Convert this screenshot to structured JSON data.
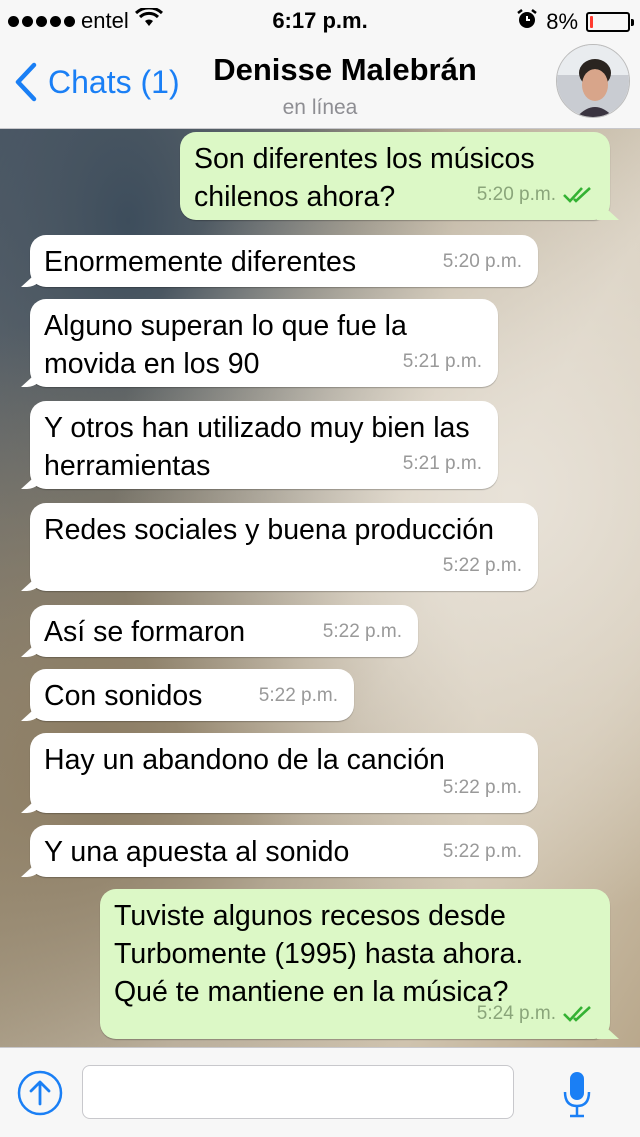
{
  "status_bar": {
    "carrier": "entel",
    "time": "6:17 p.m.",
    "battery": "8%",
    "battery_level": 0.08
  },
  "nav": {
    "back_label": "Chats (1)",
    "contact_name": "Denisse Malebrán",
    "contact_status": "en línea"
  },
  "messages": [
    {
      "direction": "out",
      "text": "Son diferentes los músicos chilenos ahora?",
      "time": "5:20 p.m.",
      "read": true
    },
    {
      "direction": "in",
      "text": "Enormemente diferentes",
      "time": "5:20 p.m."
    },
    {
      "direction": "in",
      "text": "Alguno superan lo que fue la movida en los 90",
      "time": "5:21 p.m."
    },
    {
      "direction": "in",
      "text": "Y otros han utilizado muy bien las herramientas",
      "time": "5:21 p.m."
    },
    {
      "direction": "in",
      "text": "Redes sociales y buena producción",
      "time": "5:22 p.m."
    },
    {
      "direction": "in",
      "text": "Así se formaron",
      "time": "5:22 p.m."
    },
    {
      "direction": "in",
      "text": "Con sonidos",
      "time": "5:22 p.m."
    },
    {
      "direction": "in",
      "text": "Hay un abandono de la canción",
      "time": "5:22 p.m."
    },
    {
      "direction": "in",
      "text": "Y una apuesta al sonido",
      "time": "5:22 p.m."
    },
    {
      "direction": "out",
      "text": "Tuviste algunos recesos desde Turbomente (1995) hasta ahora. Qué te mantiene en la música?",
      "time": "5:24 p.m.",
      "read": true
    }
  ],
  "input": {
    "value": "",
    "placeholder": ""
  },
  "icons": {
    "back": "chevron-left-icon",
    "attach": "upload-icon",
    "mic": "microphone-icon",
    "read_receipt": "double-check-icon",
    "wifi": "wifi-icon",
    "alarm": "alarm-icon"
  },
  "colors": {
    "accent": "#1a7ff5",
    "outgoing_bubble": "#dcf8c6",
    "incoming_bubble": "#ffffff",
    "read_check": "#34b233",
    "battery_low": "#ff3b30"
  }
}
